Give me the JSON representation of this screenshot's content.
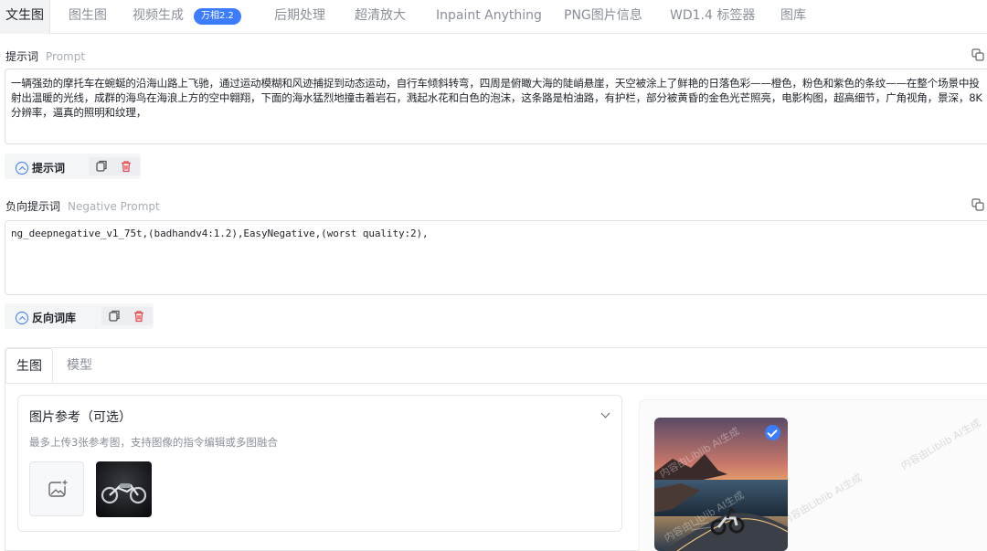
{
  "nav": {
    "tabs": [
      {
        "label": "文生图"
      },
      {
        "label": "图生图"
      },
      {
        "label": "视频生成"
      },
      {
        "label": "后期处理"
      },
      {
        "label": "超清放大"
      },
      {
        "label": "Inpaint Anything"
      },
      {
        "label": "PNG图片信息"
      },
      {
        "label": "WD1.4 标签器"
      },
      {
        "label": "图库"
      }
    ],
    "video_badge": "万相2.2",
    "active_tab": "文生图"
  },
  "prompt": {
    "label": "提示词",
    "label_en": "Prompt",
    "value": "一辆强劲的摩托车在蜿蜒的沿海山路上飞驰，通过运动模糊和风迹捕捉到动态运动，自行车倾斜转弯，四周是俯瞰大海的陡峭悬崖，天空被涂上了鲜艳的日落色彩——橙色，粉色和紫色的条纹——在整个场景中投射出温暖的光线，成群的海鸟在海浪上方的空中翱翔，下面的海水猛烈地撞击着岩石，溅起水花和白色的泡沫，这条路是柏油路，有护栏，部分被黄昏的金色光芒照亮，电影构图，超高细节，广角视角，景深，8K分辨率，逼真的照明和纹理，",
    "toggle_label": "提示词"
  },
  "negative": {
    "label": "负向提示词",
    "label_en": "Negative Prompt",
    "value": "ng_deepnegative_v1_75t,(badhandv4:1.2),EasyNegative,(worst quality:2),",
    "toggle_label": "反向词库"
  },
  "panel": {
    "tabs": [
      {
        "label": "生图"
      },
      {
        "label": "模型"
      }
    ],
    "ref": {
      "title": "图片参考（可选）",
      "subtitle": "最多上传3张参考图，支持图像的指令编辑或多图融合"
    },
    "watermark": "内容由Liblib AI生成"
  },
  "colors": {
    "accent": "#3c7cff",
    "delete": "#e5484d"
  },
  "icons": [
    "copy-icon",
    "trash-icon",
    "chevron-down-icon",
    "image-add-icon",
    "check-icon",
    "collapse-icon"
  ]
}
